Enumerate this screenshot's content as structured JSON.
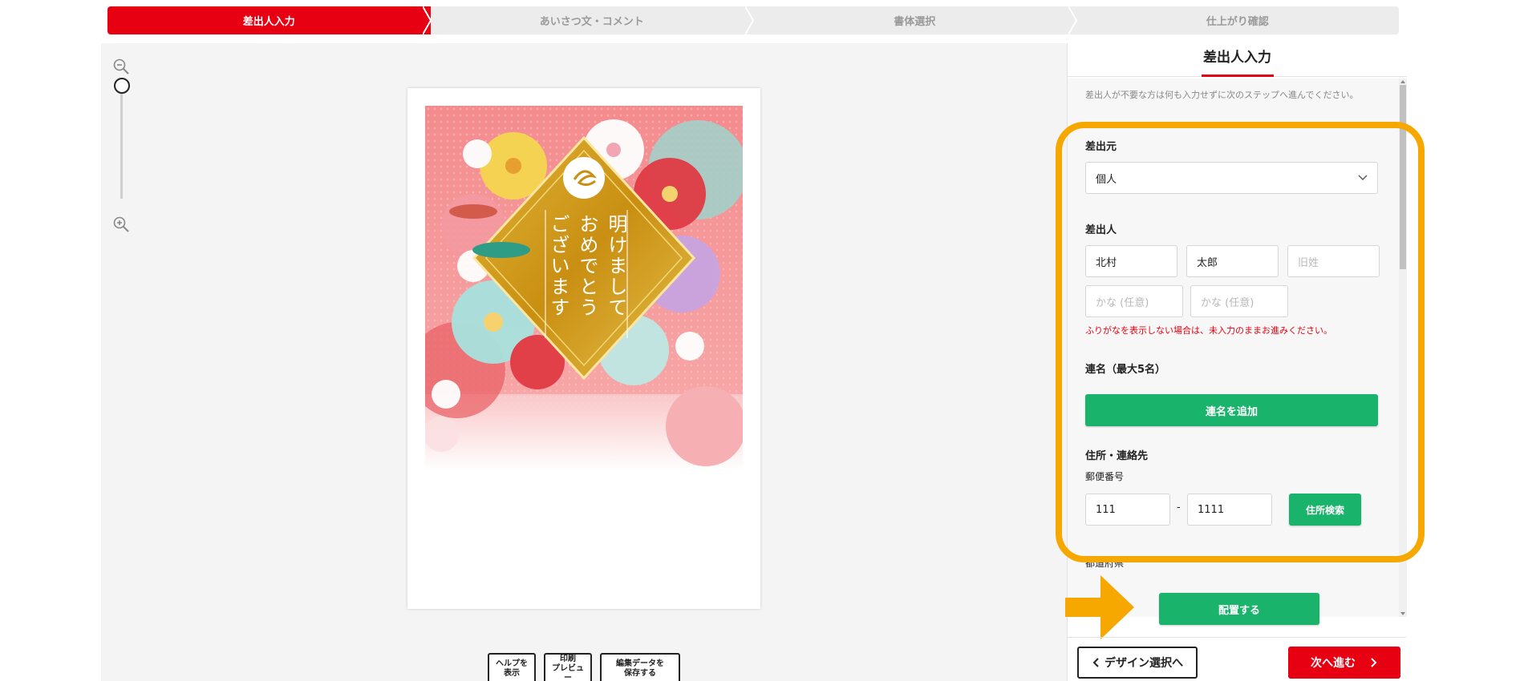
{
  "steps": [
    {
      "label": "差出人入力",
      "active": true
    },
    {
      "label": "あいさつ文・コメント",
      "active": false
    },
    {
      "label": "書体選択",
      "active": false
    },
    {
      "label": "仕上がり確認",
      "active": false
    }
  ],
  "zoom": {
    "level": 0.0
  },
  "card": {
    "greeting_lines": [
      "明けまして",
      "おめでとう",
      "ございます"
    ]
  },
  "tools": {
    "help": "ヘルプを\n表示",
    "print": "印刷\nプレビュー",
    "save": "編集データを\n保存する"
  },
  "panel": {
    "title": "差出人入力",
    "note": "差出人が不要な方は何も入力せずに次のステップへ進んでください。",
    "origin_label": "差出元",
    "origin_value": "個人",
    "sender_label": "差出人",
    "last_name": "北村",
    "first_name": "太郎",
    "maiden_placeholder": "旧姓",
    "kana_placeholder_1": "かな (任意)",
    "kana_placeholder_2": "かな (任意)",
    "kana_note": "ふりがなを表示しない場合は、未入力のままお進みください。",
    "joint_label": "連名（最大5名）",
    "add_joint_button": "連名を追加",
    "address_label": "住所・連絡先",
    "postal_label": "郵便番号",
    "postal_1": "111",
    "postal_dash": "-",
    "postal_2": "1111",
    "address_search_button": "住所検索",
    "prefecture_label": "都道府県"
  },
  "actions": {
    "place_button": "配置する",
    "back_button": "デザイン選択へ",
    "next_button": "次へ進む"
  },
  "colors": {
    "accent_red": "#e60012",
    "green": "#19b36b",
    "highlight_orange": "#f7a800"
  }
}
